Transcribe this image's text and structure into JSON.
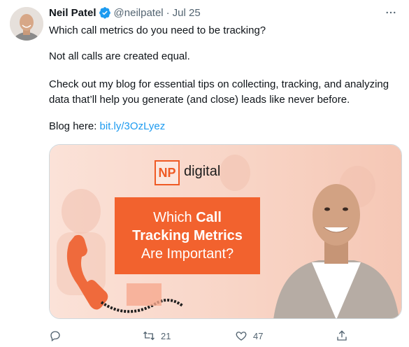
{
  "tweet": {
    "author_name": "Neil Patel",
    "handle": "@neilpatel",
    "separator": "·",
    "date": "Jul 25",
    "line1": "Which call metrics do you need to be tracking?",
    "line2": "Not all calls are created equal.",
    "line3": "Check out my blog for essential tips on collecting, tracking, and analyzing data that’ll help you generate (and close) leads like never before.",
    "line4_prefix": "Blog here: ",
    "link_text": "bit.ly/3OzLyez"
  },
  "media": {
    "logo_mark": "NP",
    "logo_word": "digital",
    "headline_pre": "Which ",
    "headline_bold1": "Call",
    "headline_bold2": "Tracking Metrics",
    "headline_post": "Are Important?"
  },
  "actions": {
    "reply_count": "",
    "retweet_count": "21",
    "like_count": "47"
  },
  "icons": [
    "verified-badge-icon",
    "more-icon",
    "reply-icon",
    "retweet-icon",
    "like-icon",
    "share-icon"
  ],
  "colors": {
    "accent": "#1d9bf0",
    "brand_orange": "#f2622e",
    "muted": "#536471"
  }
}
